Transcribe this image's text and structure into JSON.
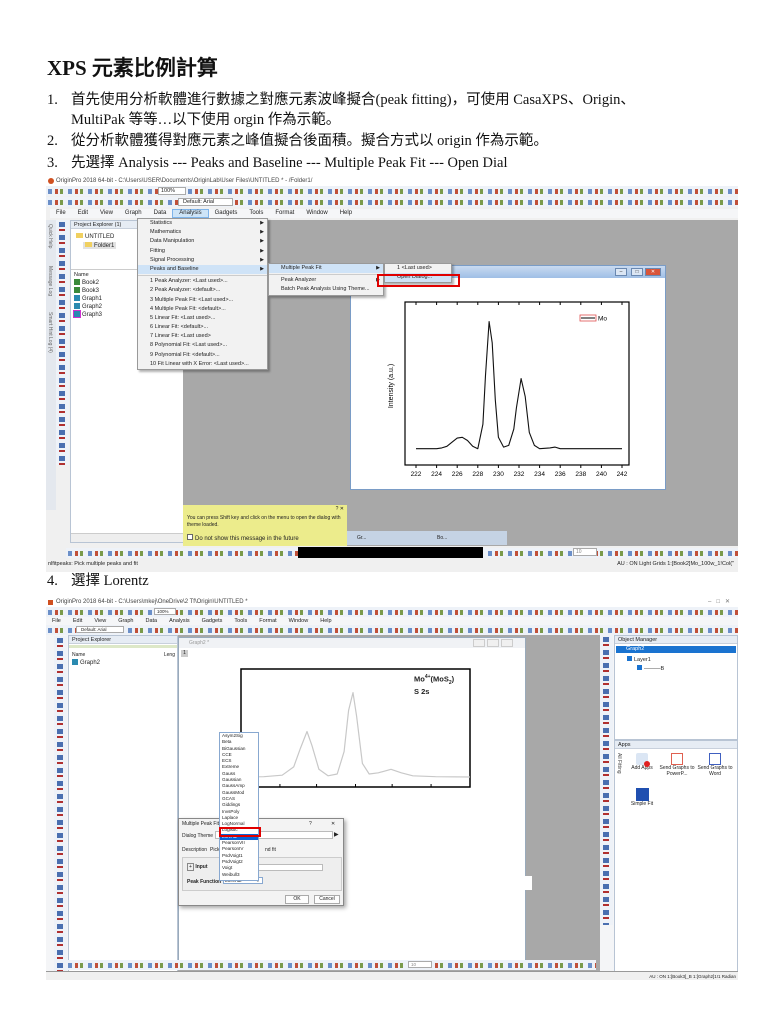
{
  "doc": {
    "title": "XPS 元素比例計算",
    "steps": [
      {
        "num": "1.",
        "line1": "首先使用分析軟體進行數據之對應元素波峰擬合(peak fitting)，可使用 CasaXPS、Origin、",
        "line2": "MultiPak 等等…以下使用 orgin 作為示範。"
      },
      {
        "num": "2.",
        "line1": "從分析軟體獲得對應元素之峰值擬合後面積。擬合方式以 origin 作為示範。"
      },
      {
        "num": "3.",
        "line1": "先選擇 Analysis --- Peaks and Baseline --- Multiple Peak Fit --- Open Dial"
      },
      {
        "num": "4.",
        "line1": "選擇 Lorentz"
      }
    ]
  },
  "s1": {
    "window_title": "OriginPro 2018 64-bit - C:\\Users\\USER\\Documents\\OriginLab\\User Files\\UNTITLED * - /Folder1/",
    "zoom": "100%",
    "font": "Default: Arial",
    "menubar": [
      "File",
      "Edit",
      "View",
      "Graph",
      "Data",
      "Analysis",
      "Gadgets",
      "Tools",
      "Format",
      "Window",
      "Help"
    ],
    "side_tabs": [
      "Quick Help",
      "Message Log",
      "Smart Hint Log (4)"
    ],
    "project_explorer": {
      "header": "Project Explorer (1)",
      "root": "UNTITLED",
      "folder": "Folder1",
      "name_col": "Name",
      "items": [
        "Book2",
        "Book3",
        "Graph1",
        "Graph2",
        "Graph3"
      ]
    },
    "analysis_menu": {
      "sub": [
        "Statistics",
        "Mathematics",
        "Data Manipulation",
        "Fitting",
        "Signal Processing",
        "Peaks and Baseline"
      ],
      "recent": [
        "1 Peak Analyzer: <Last used>...",
        "2 Peak Analyzer: <default>...",
        "3 Multiple Peak Fit: <Last used>...",
        "4 Multiple Peak Fit: <default>...",
        "5 Linear Fit: <Last used>...",
        "6 Linear Fit: <default>...",
        "7 Linear Fit: <Last used>",
        "8 Polynomial Fit: <Last used>...",
        "9 Polynomial Fit: <default>...",
        "10 Fit Linear with X Error: <Last used>..."
      ]
    },
    "peaks_menu": [
      "Multiple Peak Fit",
      "Peak Analyzer",
      "Batch Peak Analysis Using Theme..."
    ],
    "mpf_menu": [
      "1 <Last used>",
      "Open Dialog..."
    ],
    "hint": {
      "text": "You can press Shift key and click on the menu to open the dialog with theme loaded.",
      "checkbox": "Do not show this message in the future"
    },
    "minimized": [
      "Gr...",
      "Bo..."
    ],
    "font_size": "10",
    "status_left": "nlfitpeaks: Pick multiple peaks and fit",
    "status_right": "AU : ON  Light Grids  1:[Book2]Mo_100w_1!Col(\""
  },
  "s2": {
    "window_title": "OriginPro 2018 64-bit - C:\\Users\\mkej\\OneDrive\\2 Tf\\Origin\\UNTITLED *",
    "zoom": "100%",
    "font": "Default: Arial",
    "menubar": [
      "File",
      "Edit",
      "View",
      "Graph",
      "Data",
      "Analysis",
      "Gadgets",
      "Tools",
      "Format",
      "Window",
      "Help"
    ],
    "project_explorer": {
      "header": "Project Explorer",
      "name_col": "Name",
      "length_col": "Leng",
      "items": [
        "Graph2"
      ]
    },
    "graph_title": "Graph2 *",
    "layer_badge": "1",
    "label1": "Mo",
    "label1_sup": "4+",
    "label1_rest": "(MoS",
    "label1_sub": "2",
    "label1_end": ")",
    "label2": "S 2s",
    "peak_functions": [
      "Asym2Sig",
      "Beta",
      "BiGaussian",
      "CCE",
      "ECS",
      "Extreme",
      "Gauss",
      "Gaussian",
      "GaussAmp",
      "GaussMod",
      "GCAS",
      "Giddings",
      "InvsPoly",
      "Laplace",
      "LogNormal",
      "Logistic",
      "Lorentz",
      "PearsonVII",
      "PearsonIV",
      "PsdVoigt1",
      "PsdVoigt2",
      "Voigt",
      "Weibull3"
    ],
    "selected_index": 16,
    "dialog": {
      "title": "Multiple Peak Fit",
      "help": "?",
      "close": "✕",
      "theme_label": "Dialog Theme",
      "desc_label": "Description",
      "desc_value": "Pick",
      "desc_tail": "nd fit",
      "input_label": "Input",
      "peak_function_label": "Peak Function",
      "peak_function_value": "Lorentz",
      "ok": "OK",
      "cancel": "Cancel"
    },
    "object_manager": {
      "header": "Object Manager",
      "graph": "Graph2",
      "layer": "Layer1",
      "plot": "B"
    },
    "apps": {
      "header": "Apps",
      "side_tab": "All  Fitting",
      "items": [
        "Add Apps",
        "Send Graphs to PowerP...",
        "Send Graphs to Word",
        "Simple Fit"
      ]
    },
    "font_size": "10",
    "status_right": "AU : ON  1:[Book3]_B 1:[Graph2]1!1 Radian"
  },
  "chart_data": [
    {
      "type": "line",
      "title": "",
      "xlabel": "",
      "ylabel": "Intensity (a.u.)",
      "xlim": [
        222,
        242
      ],
      "ylim": [
        0,
        1
      ],
      "xticks": [
        "222",
        "224",
        "226",
        "228",
        "230",
        "232",
        "234",
        "236",
        "238",
        "240",
        "242"
      ],
      "legend": {
        "entries": [
          "Mo"
        ],
        "placement": "top-right"
      },
      "color": "#111111",
      "x": [
        222,
        223,
        224,
        224.5,
        225,
        225.5,
        226,
        226.5,
        227,
        227.5,
        228,
        228.5,
        228.75,
        229.1,
        229.4,
        229.7,
        230,
        230.5,
        231,
        231.5,
        231.75,
        232.2,
        232.6,
        233,
        233.5,
        234,
        235,
        235.5,
        236,
        237,
        238,
        239,
        240,
        241,
        242
      ],
      "y": [
        0.1,
        0.1,
        0.1,
        0.105,
        0.115,
        0.14,
        0.165,
        0.17,
        0.15,
        0.115,
        0.1,
        0.25,
        0.55,
        0.88,
        0.75,
        0.4,
        0.17,
        0.11,
        0.12,
        0.22,
        0.35,
        0.53,
        0.42,
        0.2,
        0.12,
        0.1,
        0.105,
        0.11,
        0.1,
        0.1,
        0.1,
        0.1,
        0.1,
        0.1,
        0.1
      ]
    },
    {
      "type": "line",
      "title": "",
      "xlabel": "",
      "ylabel": "",
      "xlim": [
        0,
        100
      ],
      "ylim": [
        0,
        1
      ],
      "color": "#c8c8c8",
      "annotations": [
        "Mo4+(MoS2)",
        "S 2s"
      ],
      "x": [
        0,
        10,
        18,
        23,
        26,
        28.8,
        31,
        34,
        38,
        42,
        45,
        47,
        48.9,
        50.5,
        53,
        56,
        60,
        65.5,
        70,
        75,
        85,
        100
      ],
      "y": [
        0.085,
        0.087,
        0.1,
        0.17,
        0.33,
        0.47,
        0.35,
        0.15,
        0.095,
        0.11,
        0.3,
        0.65,
        0.8,
        0.6,
        0.2,
        0.11,
        0.12,
        0.15,
        0.12,
        0.095,
        0.087,
        0.085
      ]
    }
  ]
}
